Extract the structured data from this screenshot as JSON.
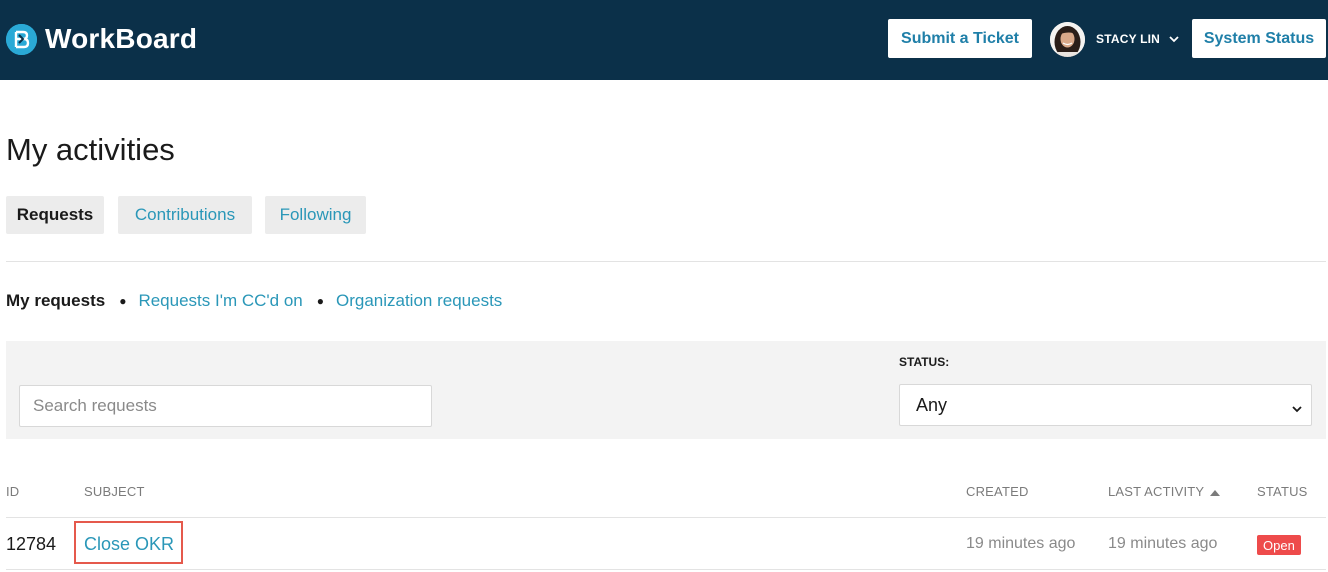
{
  "header": {
    "logo_text": "WorkBoard",
    "submit_ticket_label": "Submit a Ticket",
    "user_name": "STACY LIN",
    "system_status_label": "System Status"
  },
  "page": {
    "title": "My activities"
  },
  "tabs": [
    {
      "label": "Requests",
      "active": true
    },
    {
      "label": "Contributions",
      "active": false
    },
    {
      "label": "Following",
      "active": false
    }
  ],
  "subnav": {
    "active": "My requests",
    "links": [
      "Requests I'm CC'd on",
      "Organization requests"
    ]
  },
  "filters": {
    "search_placeholder": "Search requests",
    "status_label": "STATUS:",
    "status_value": "Any"
  },
  "table": {
    "columns": {
      "id": "ID",
      "subject": "SUBJECT",
      "created": "CREATED",
      "last_activity": "LAST ACTIVITY",
      "status": "STATUS"
    },
    "rows": [
      {
        "id": "12784",
        "subject": "Close OKR",
        "created": "19 minutes ago",
        "last_activity": "19 minutes ago",
        "status": "Open"
      }
    ]
  },
  "colors": {
    "header_bg": "#0b3049",
    "accent_link": "#2a97b8",
    "status_open": "#ee4b4b",
    "highlight_box": "#e5594c"
  },
  "icons": [
    "workboard-logo-icon",
    "chevron-down-icon",
    "sort-ascending-icon",
    "avatar"
  ]
}
